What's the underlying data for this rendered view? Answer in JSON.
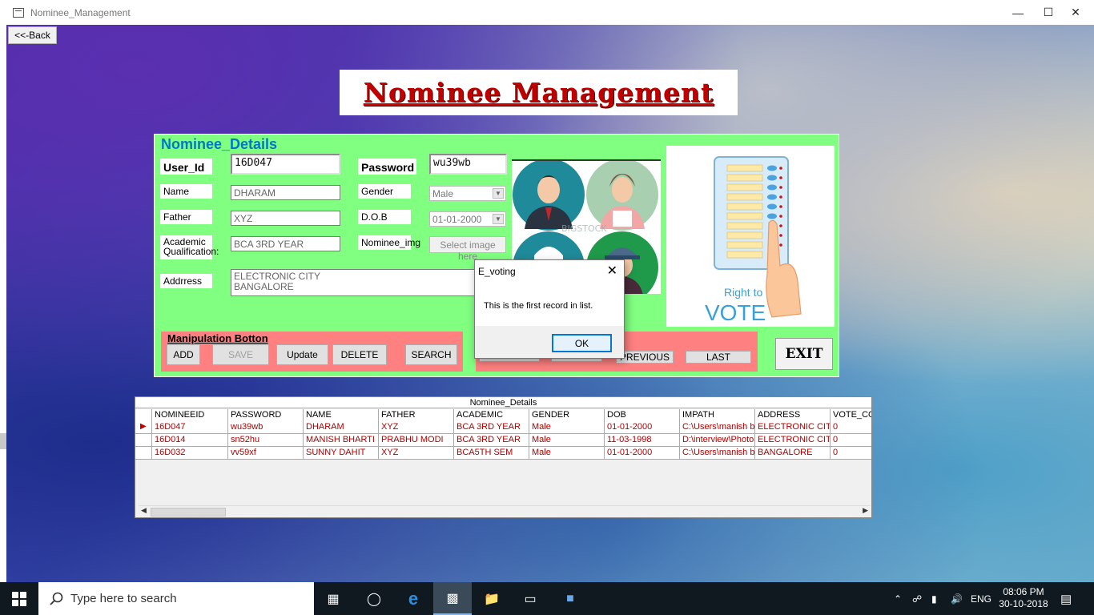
{
  "window": {
    "title": "Nominee_Management"
  },
  "back_button": "<<-Back",
  "heading": "Nominee Management",
  "details": {
    "legend": "Nominee_Details",
    "user_id_label": "User_Id",
    "user_id_value": "16D047",
    "password_label": "Password",
    "password_value": "wu39wb",
    "name_label": "Name",
    "name_value": "DHARAM",
    "gender_label": "Gender",
    "gender_value": "Male",
    "father_label": "Father",
    "father_value": "XYZ",
    "dob_label": "D.O.B",
    "dob_value": "01-01-2000",
    "academic_label": "Academic Qualification:",
    "academic_value": "BCA 3RD YEAR",
    "nominee_img_label": "Nominee_img",
    "select_image_button": "Select image here",
    "address_label": "Addrress",
    "address_line1": "ELECTRONIC CITY",
    "address_line2": "BANGALORE",
    "image_watermark": "BIGSTOCK",
    "vote_caption_top": "Right to",
    "vote_caption_bottom": "VOTE"
  },
  "manipulation": {
    "title": "Manipulation Botton",
    "add": "ADD",
    "save": "SAVE",
    "update": "Update",
    "delete": "DELETE",
    "search": "SEARCH"
  },
  "navigation": {
    "previous": "PREVIOUS",
    "last": "LAST"
  },
  "exit_button": "EXIT",
  "grid": {
    "caption": "Nominee_Details",
    "columns": [
      "NOMINEEID",
      "PASSWORD",
      "NAME",
      "FATHER",
      "ACADEMIC",
      "GENDER",
      "DOB",
      "IMPATH",
      "ADDRESS",
      "VOTE_CO"
    ],
    "rows": [
      [
        "16D047",
        "wu39wb",
        "DHARAM",
        "XYZ",
        "BCA 3RD YEAR",
        "Male",
        "01-01-2000",
        "C:\\Users\\manish bl",
        "ELECTRONIC CITY",
        "0"
      ],
      [
        "16D014",
        "sn52hu",
        "MANISH BHARTI",
        "PRABHU MODI",
        "BCA 3RD YEAR",
        "Male",
        "11-03-1998",
        "D:\\interview\\Photo",
        "ELECTRONIC CITY",
        "0"
      ],
      [
        "16D032",
        "vv59xf",
        "SUNNY DAHIT",
        "XYZ",
        "BCA5TH SEM",
        "Male",
        "01-01-2000",
        "C:\\Users\\manish bl",
        "BANGALORE",
        "0"
      ]
    ]
  },
  "dialog": {
    "title": "E_voting",
    "message": "This is the first record in list.",
    "ok": "OK"
  },
  "taskbar": {
    "search_placeholder": "Type here to search",
    "language": "ENG",
    "time": "08:06 PM",
    "date": "30-10-2018"
  },
  "colors": {
    "group_bg": "#80ff80",
    "panel_pink": "#ff8080",
    "heading_red": "#c00000",
    "legend_blue": "#0078c8",
    "grid_text_red": "#b00000"
  }
}
